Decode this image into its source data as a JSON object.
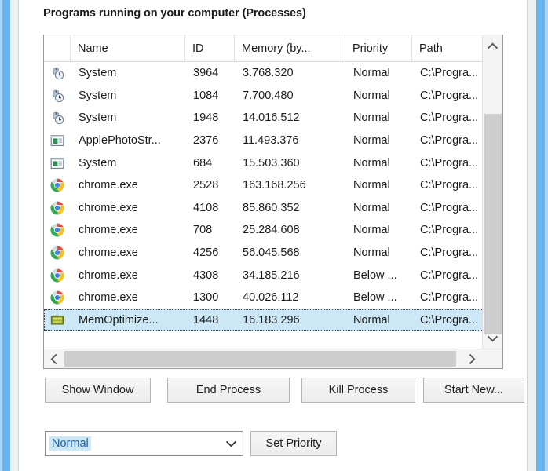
{
  "window": {
    "border_color": "#6ab4f0",
    "client_bg": "#ffffff"
  },
  "group": {
    "title": "Programs running on your computer (Processes)"
  },
  "listview": {
    "columns": [
      {
        "key": "icon",
        "label": ""
      },
      {
        "key": "name",
        "label": "Name"
      },
      {
        "key": "id",
        "label": "ID"
      },
      {
        "key": "memory",
        "label": "Memory (by..."
      },
      {
        "key": "priority",
        "label": "Priority"
      },
      {
        "key": "path",
        "label": "Path"
      }
    ],
    "selection_color": "#cce8f7",
    "rows": [
      {
        "icon": "system-clock-icon",
        "name": "System",
        "id": "3964",
        "memory": "3.768.320",
        "priority": "Normal",
        "path": "C:\\Progra...",
        "selected": false
      },
      {
        "icon": "system-clock-icon",
        "name": "System",
        "id": "1084",
        "memory": "7.700.480",
        "priority": "Normal",
        "path": "C:\\Progra...",
        "selected": false
      },
      {
        "icon": "system-clock-icon",
        "name": "System",
        "id": "1948",
        "memory": "14.016.512",
        "priority": "Normal",
        "path": "C:\\Progra...",
        "selected": false
      },
      {
        "icon": "window-app-icon",
        "name": "ApplePhotoStr...",
        "id": "2376",
        "memory": "11.493.376",
        "priority": "Normal",
        "path": "C:\\Progra...",
        "selected": false
      },
      {
        "icon": "window-app-icon",
        "name": "System",
        "id": "684",
        "memory": "15.503.360",
        "priority": "Normal",
        "path": "C:\\Progra...",
        "selected": false
      },
      {
        "icon": "chrome-icon",
        "name": "chrome.exe",
        "id": "2528",
        "memory": "163.168.256",
        "priority": "Normal",
        "path": "C:\\Progra...",
        "selected": false
      },
      {
        "icon": "chrome-icon",
        "name": "chrome.exe",
        "id": "4108",
        "memory": "85.860.352",
        "priority": "Normal",
        "path": "C:\\Progra...",
        "selected": false
      },
      {
        "icon": "chrome-icon",
        "name": "chrome.exe",
        "id": "708",
        "memory": "25.284.608",
        "priority": "Normal",
        "path": "C:\\Progra...",
        "selected": false
      },
      {
        "icon": "chrome-icon",
        "name": "chrome.exe",
        "id": "4256",
        "memory": "56.045.568",
        "priority": "Normal",
        "path": "C:\\Progra...",
        "selected": false
      },
      {
        "icon": "chrome-icon",
        "name": "chrome.exe",
        "id": "4308",
        "memory": "34.185.216",
        "priority": "Below ...",
        "path": "C:\\Progra...",
        "selected": false
      },
      {
        "icon": "chrome-icon",
        "name": "chrome.exe",
        "id": "1300",
        "memory": "40.026.112",
        "priority": "Below ...",
        "path": "C:\\Progra...",
        "selected": false
      },
      {
        "icon": "memoptimizer-icon",
        "name": "MemOptimize...",
        "id": "1448",
        "memory": "16.183.296",
        "priority": "Normal",
        "path": "C:\\Progra...",
        "selected": true
      }
    ],
    "vscroll": {
      "up_icon": "chevron-up-icon",
      "down_icon": "chevron-down-icon"
    },
    "hscroll": {
      "left_icon": "chevron-left-icon",
      "right_icon": "chevron-right-icon"
    }
  },
  "actions": {
    "buttons": [
      {
        "label": "Show Window"
      },
      {
        "label": "End Process"
      },
      {
        "label": "Kill Process"
      },
      {
        "label": "Start New..."
      }
    ]
  },
  "priority": {
    "selected_value": "Normal",
    "dropdown_icon": "chevron-down-icon",
    "set_button_label": "Set Priority"
  }
}
